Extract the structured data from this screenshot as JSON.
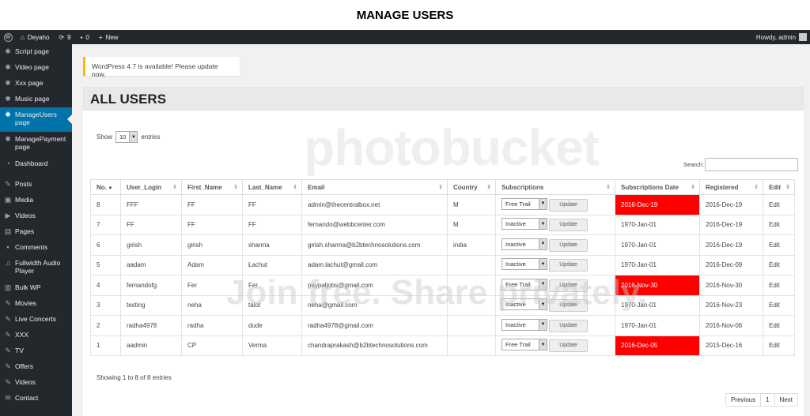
{
  "caption": "MANAGE USERS",
  "adminbar": {
    "site_name": "Deyaho",
    "updates_count": "9",
    "comments_count": "0",
    "new_label": "New",
    "howdy": "Howdy, admin"
  },
  "sidebar": {
    "items": [
      {
        "label": "Script page",
        "icon": "gear-icon"
      },
      {
        "label": "Video page",
        "icon": "gear-icon"
      },
      {
        "label": "Xxx page",
        "icon": "gear-icon"
      },
      {
        "label": "Music page",
        "icon": "gear-icon"
      },
      {
        "label": "ManageUsers page",
        "icon": "gear-icon"
      },
      {
        "label": "ManagePayment page",
        "icon": "gear-icon"
      },
      {
        "label": "Dashboard",
        "icon": "dashboard-icon"
      },
      {
        "label": "Posts",
        "icon": "pin-icon"
      },
      {
        "label": "Media",
        "icon": "media-icon"
      },
      {
        "label": "Videos",
        "icon": "video-icon"
      },
      {
        "label": "Pages",
        "icon": "pages-icon"
      },
      {
        "label": "Comments",
        "icon": "comment-icon"
      },
      {
        "label": "Fullwidth Audio Player",
        "icon": "music-icon"
      },
      {
        "label": "Bulk WP",
        "icon": "trash-icon"
      },
      {
        "label": "Movies",
        "icon": "pin-icon"
      },
      {
        "label": "Live Concerts",
        "icon": "pin-icon"
      },
      {
        "label": "XXX",
        "icon": "pin-icon"
      },
      {
        "label": "TV",
        "icon": "pin-icon"
      },
      {
        "label": "Offers",
        "icon": "pin-icon"
      },
      {
        "label": "Videos",
        "icon": "pin-icon"
      },
      {
        "label": "Contact",
        "icon": "mail-icon"
      }
    ]
  },
  "notice": "WordPress 4.7 is available! Please update now.",
  "page_title": "ALL USERS",
  "controls": {
    "show_label": "Show",
    "entries_value": "10",
    "entries_label": "entries",
    "search_label": "Search:"
  },
  "table": {
    "headers": [
      "No.",
      "User_Login",
      "First_Name",
      "Last_Name",
      "Email",
      "Country",
      "Subscriptions",
      "Subscriptions Date",
      "Registered",
      "Edit"
    ],
    "rows": [
      {
        "no": "8",
        "login": "FFF",
        "first": "FF",
        "last": "FF",
        "email": "admin@thecentralbox.net",
        "country": "M",
        "sub": "Free Trail",
        "update": "Update",
        "subdate": "2016-Dec-19",
        "red": true,
        "registered": "2016-Dec-19",
        "edit": "Edit"
      },
      {
        "no": "7",
        "login": "FF",
        "first": "FF",
        "last": "FF",
        "email": "fernando@webbcenter.com",
        "country": "M",
        "sub": "Inactive",
        "update": "Update",
        "subdate": "1970-Jan-01",
        "red": false,
        "registered": "2016-Dec-19",
        "edit": "Edit"
      },
      {
        "no": "6",
        "login": "girish",
        "first": "girish",
        "last": "sharma",
        "email": "girish.sharma@b2btechnosolutions.com",
        "country": "india",
        "sub": "Inactive",
        "update": "Update",
        "subdate": "1970-Jan-01",
        "red": false,
        "registered": "2016-Dec-19",
        "edit": "Edit"
      },
      {
        "no": "5",
        "login": "aadam",
        "first": "Adam",
        "last": "Łachut",
        "email": "adam.lachut@gmail.com",
        "country": "",
        "sub": "Inactive",
        "update": "Update",
        "subdate": "1970-Jan-01",
        "red": false,
        "registered": "2016-Dec-09",
        "edit": "Edit"
      },
      {
        "no": "4",
        "login": "fernandofg",
        "first": "Fer",
        "last": "Fer",
        "email": "paypaljobs@gmail.com",
        "country": "",
        "sub": "Free Trail",
        "update": "Update",
        "subdate": "2016-Nov-30",
        "red": true,
        "registered": "2016-Nov-30",
        "edit": "Edit"
      },
      {
        "no": "3",
        "login": "testing",
        "first": "neha",
        "last": "talot",
        "email": "neha@gmail.com",
        "country": "",
        "sub": "Inactive",
        "update": "Update",
        "subdate": "1970-Jan-01",
        "red": false,
        "registered": "2016-Nov-23",
        "edit": "Edit"
      },
      {
        "no": "2",
        "login": "radha4978",
        "first": "radha",
        "last": "dude",
        "email": "radha4978@gmail.com",
        "country": "",
        "sub": "Inactive",
        "update": "Update",
        "subdate": "1970-Jan-01",
        "red": false,
        "registered": "2016-Nov-06",
        "edit": "Edit"
      },
      {
        "no": "1",
        "login": "aadmin",
        "first": "CP",
        "last": "Verma",
        "email": "chandraprakash@b2btechnosolutions.com",
        "country": "",
        "sub": "Free Trail",
        "update": "Update",
        "subdate": "2016-Dec-05",
        "red": true,
        "registered": "2015-Dec-16",
        "edit": "Edit"
      }
    ]
  },
  "info": "Showing 1 to 8 of 8 entries",
  "pagination": {
    "previous": "Previous",
    "page": "1",
    "next": "Next"
  },
  "watermark": {
    "top": "photobucket",
    "bottom": "Join free. Share privately."
  },
  "colors": {
    "red_highlight": "#ff0000",
    "admin_blue": "#0073aa",
    "admin_dark": "#23282d"
  }
}
